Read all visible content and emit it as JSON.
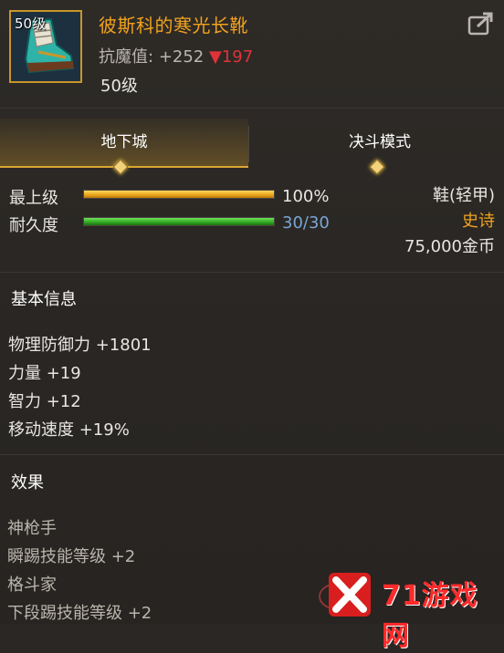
{
  "item": {
    "level_tag": "50级",
    "name": "彼斯科的寒光长靴",
    "magic_resist_label": "抗魔值:",
    "magic_resist_value": "+252",
    "magic_resist_down": "▼197",
    "level_text": "50级"
  },
  "tabs": [
    {
      "label": "地下城",
      "active": true
    },
    {
      "label": "决斗模式",
      "active": false
    }
  ],
  "bars": {
    "grade": {
      "label": "最上级",
      "value_text": "100%",
      "fraction": 1.0
    },
    "durability": {
      "label": "耐久度",
      "value_text": "30/30",
      "fraction": 1.0
    }
  },
  "info": {
    "slot": "鞋(轻甲)",
    "rarity": "史诗",
    "price": "75,000金币"
  },
  "basic": {
    "title": "基本信息",
    "stats": [
      "物理防御力 +1801",
      "力量 +19",
      "智力 +12",
      "移动速度 +19%"
    ]
  },
  "effects": {
    "title": "效果",
    "items": [
      "神枪手",
      "瞬踢技能等级 +2",
      "格斗家",
      "下段踢技能等级 +2"
    ]
  },
  "watermark": {
    "text": "71游戏网"
  },
  "colors": {
    "accent": "#f0a21e",
    "rarity": "#f0a21e",
    "down": "#e0323a",
    "durability": "#7aa6d4"
  }
}
